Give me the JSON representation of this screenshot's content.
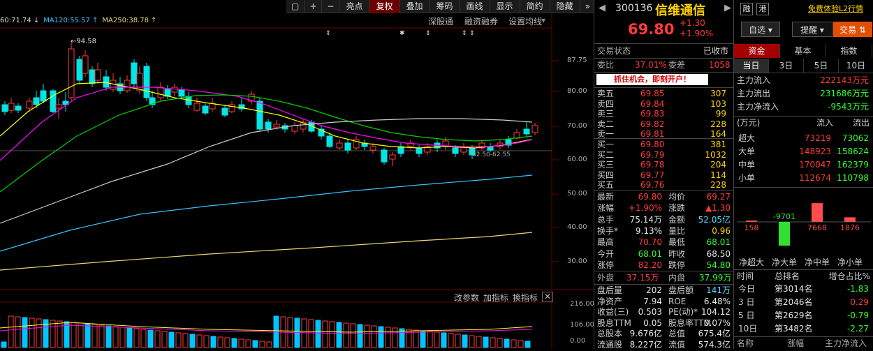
{
  "chart_toolbar": {
    "buttons": [
      "▢",
      "+",
      "−",
      "亮点",
      "复权",
      "叠加",
      "筹码",
      "画线",
      "显示",
      "简约",
      "隐藏"
    ],
    "arrow": "»",
    "active": "复权"
  },
  "ma_row": [
    {
      "text": "60:71.74 ↓",
      "color": "#d9d9d9"
    },
    {
      "text": "MA120:55.57 ↑",
      "color": "#35c3ff"
    },
    {
      "text": "MA250:38.78 ↑",
      "color": "#e8d675"
    }
  ],
  "sub_toolbar": {
    "a": "深股通",
    "b": "融资融券",
    "c": "设置均线"
  },
  "indicator_bar": {
    "a": "改参数",
    "b": "加指标",
    "c": "换指标",
    "close": "✕"
  },
  "y_axis": [
    "87.75",
    "80.00",
    "70.00",
    "60.00",
    "50.00",
    "40.00",
    "30.00"
  ],
  "vol_axis": [
    "216.00",
    "106.00",
    "0.00"
  ],
  "annotations": {
    "high": "94.58",
    "range": "62.50-62.55"
  },
  "stock": {
    "code": "300136",
    "name": "信维通信",
    "tag1": "融",
    "tag2": "港",
    "promo": "免费体验L2行情",
    "price": "69.80",
    "change": "+1.30",
    "pct": "+1.90%"
  },
  "buttons": {
    "watch": "自选 ▾",
    "remind": "提醒 ▾",
    "trade": "交易 ⇅"
  },
  "status": {
    "label": "交易状态",
    "value": "已收市"
  },
  "ratio": {
    "label1": "委比",
    "v1": "37.01%",
    "label2": "委差",
    "v2": "1058"
  },
  "banner": "抓住机会，即刻开户！",
  "asks": [
    [
      "卖五",
      "69.85",
      "307"
    ],
    [
      "卖四",
      "69.84",
      "103"
    ],
    [
      "卖三",
      "69.83",
      "99"
    ],
    [
      "卖二",
      "69.82",
      "228"
    ],
    [
      "卖一",
      "69.81",
      "164"
    ]
  ],
  "bids": [
    [
      "买一",
      "69.80",
      "381"
    ],
    [
      "买二",
      "69.79",
      "1032"
    ],
    [
      "买三",
      "69.78",
      "204"
    ],
    [
      "买四",
      "69.77",
      "114"
    ],
    [
      "买五",
      "69.76",
      "228"
    ]
  ],
  "quote": [
    [
      "最新",
      "69.80",
      "r",
      "均价",
      "69.27",
      "r"
    ],
    [
      "涨幅",
      "+1.90%",
      "r",
      "涨跌",
      "▲1.30",
      "r"
    ],
    [
      "总手",
      "75.14万",
      "w",
      "金额",
      "52.05亿",
      "c"
    ],
    [
      "换手*",
      "9.13%",
      "w",
      "量比",
      "0.96",
      "y"
    ],
    [
      "最高",
      "70.70",
      "r",
      "最低",
      "68.01",
      "g"
    ],
    [
      "今开",
      "68.01",
      "g",
      "昨收",
      "68.50",
      "w"
    ],
    [
      "涨停",
      "82.20",
      "r",
      "跌停",
      "54.80",
      "g"
    ]
  ],
  "outer": {
    "l1": "外盘",
    "v1": "37.15万",
    "l2": "内盘",
    "v2": "37.99万"
  },
  "fund": [
    [
      "盘后量",
      "202",
      "盘后额",
      "141万"
    ],
    [
      "净资产",
      "7.94",
      "ROE",
      "6.48%"
    ],
    [
      "收益(三)",
      "0.503",
      "PE(动)*",
      "104.12"
    ],
    [
      "股息TTM",
      "0.05",
      "股息率TTM",
      "0.07%"
    ],
    [
      "总股本",
      "9.676亿",
      "总值",
      "675.4亿"
    ],
    [
      "流通股",
      "8.227亿",
      "流值",
      "574.3亿"
    ]
  ],
  "rtabs": [
    "资金",
    "基本",
    "指数"
  ],
  "period": [
    "当日",
    "3日",
    "5日",
    "10日"
  ],
  "flow": [
    [
      "主力流入",
      "222143万元",
      "r"
    ],
    [
      "主力流出",
      "231686万元",
      "g"
    ],
    [
      "主力净流入",
      "-9543万元",
      "g"
    ]
  ],
  "flow_table": {
    "unit": "(万元)",
    "in": "流入",
    "out": "流出",
    "rows": [
      [
        "超大",
        "73219",
        "73062"
      ],
      [
        "大单",
        "148923",
        "158624"
      ],
      [
        "中单",
        "170047",
        "162379"
      ],
      [
        "小单",
        "112674",
        "110798"
      ]
    ]
  },
  "chart_data": {
    "type": "bar",
    "categories": [
      "净超大",
      "净大单",
      "净中单",
      "净小单"
    ],
    "values": [
      158,
      -9701,
      7668,
      1876
    ]
  },
  "rank": {
    "h1": "时间",
    "h2": "总排名",
    "h3": "增仓占比%",
    "rows": [
      [
        "今日",
        "第3014名",
        "-1.83",
        "g"
      ],
      [
        "3 日",
        "第2046名",
        "0.29",
        "r"
      ],
      [
        "5 日",
        "第2629名",
        "-0.79",
        "g"
      ],
      [
        "10日",
        "第3482名",
        "-2.27",
        "g"
      ]
    ]
  },
  "bottom": {
    "a": "名称",
    "b": "涨幅",
    "c": "主力净流入"
  }
}
